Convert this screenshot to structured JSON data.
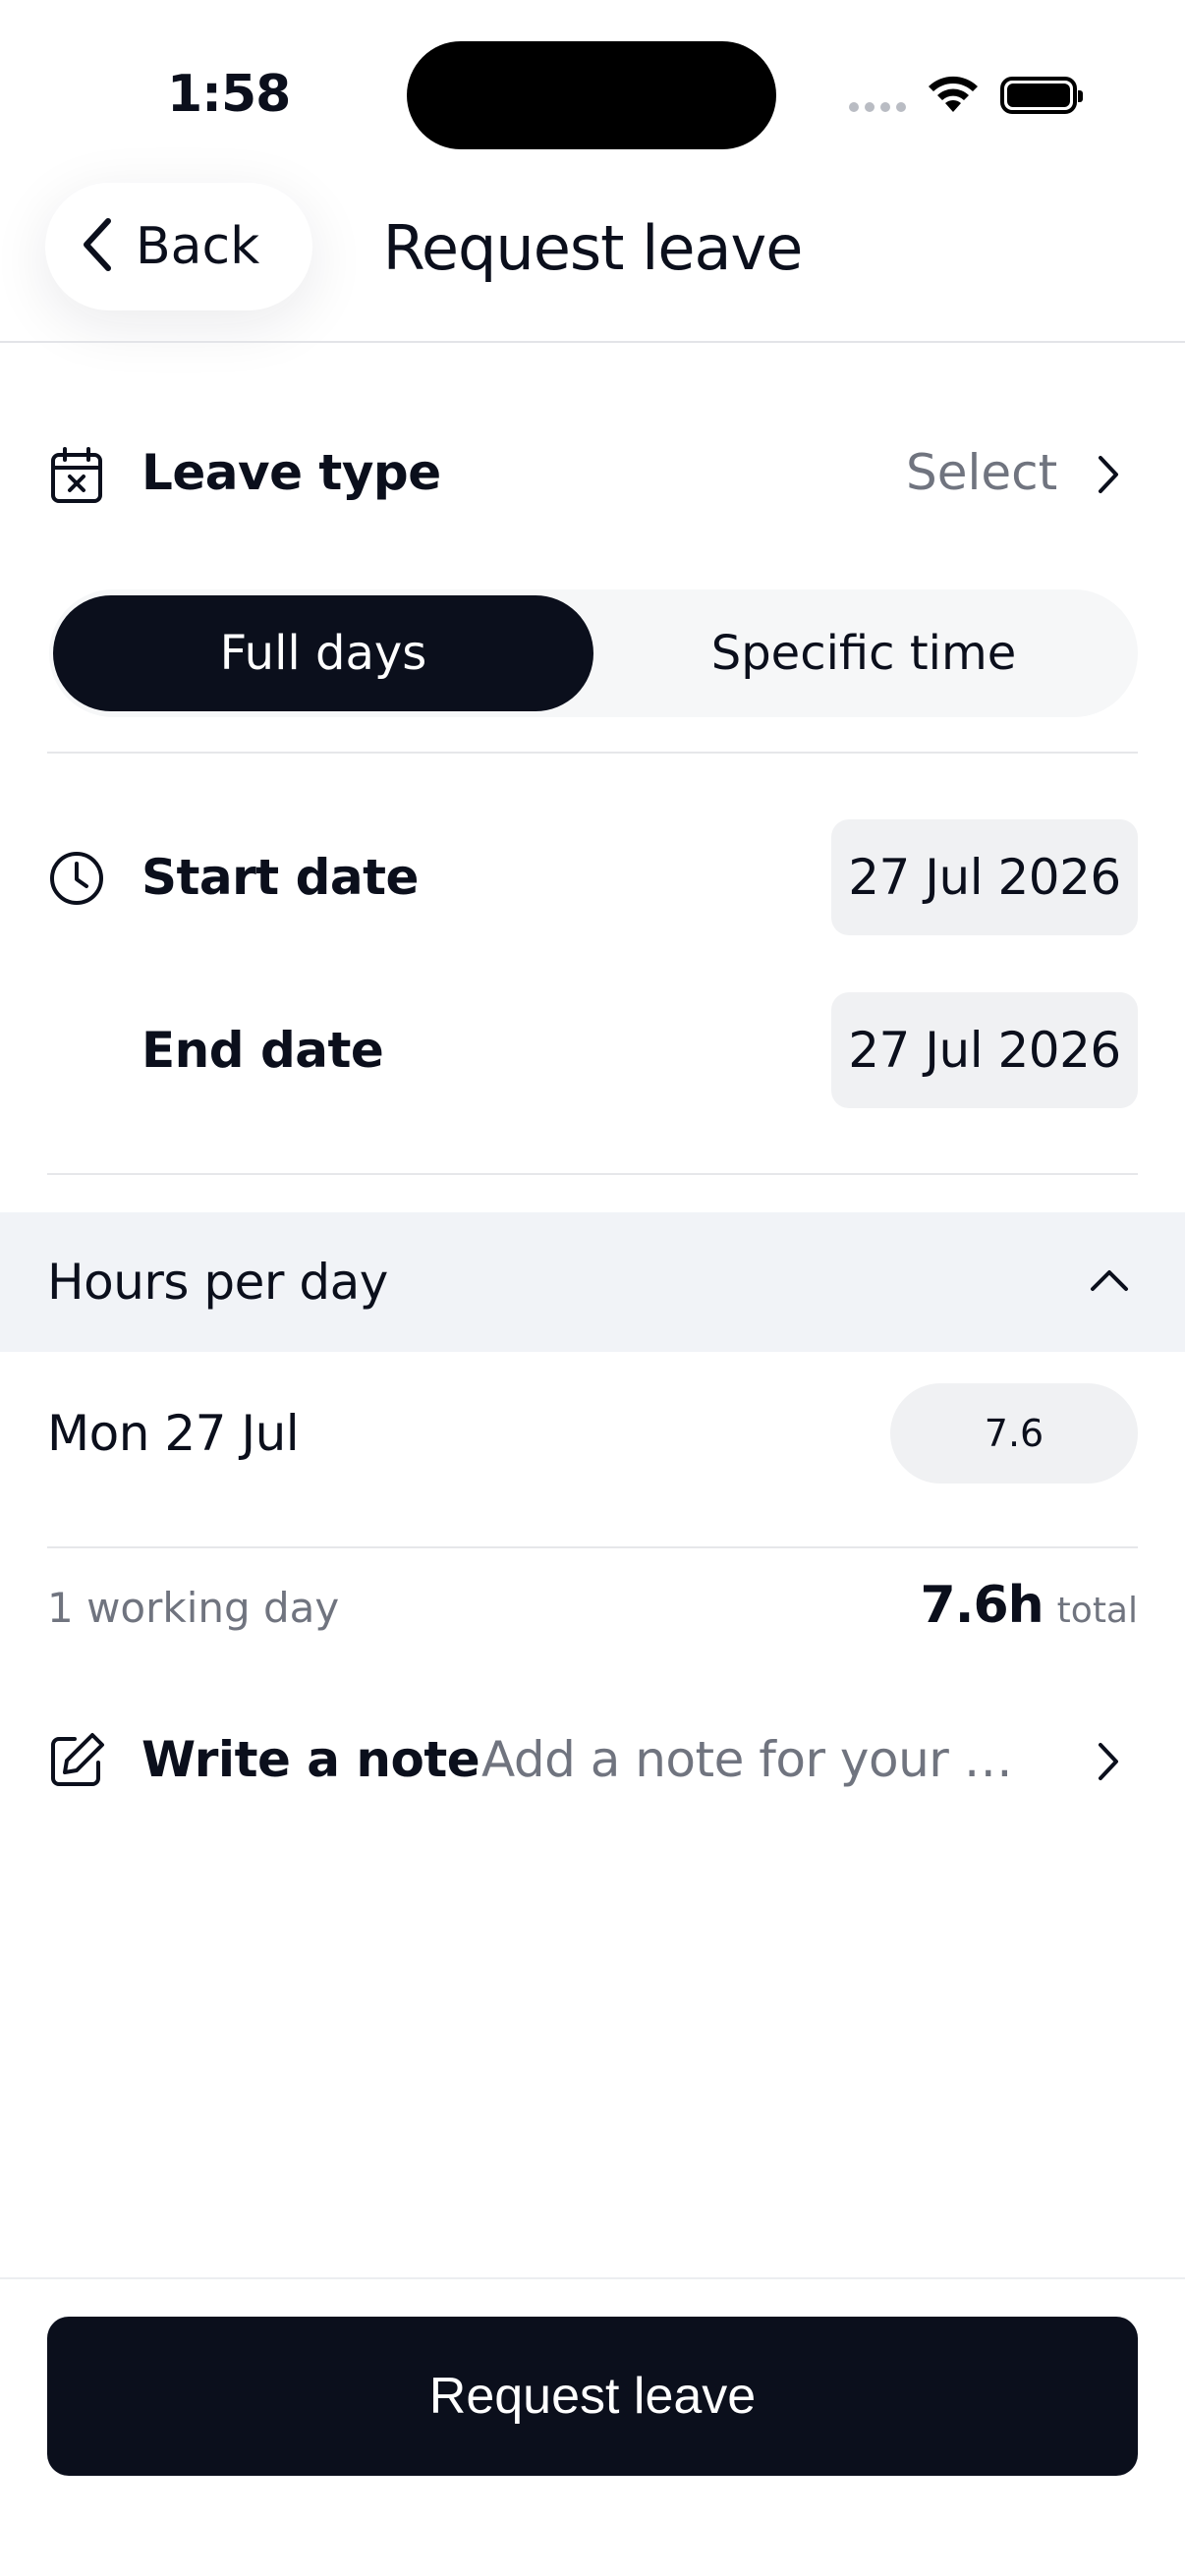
{
  "status_bar": {
    "time": "1:58"
  },
  "header": {
    "back_label": "Back",
    "title": "Request leave"
  },
  "leave_type": {
    "label": "Leave type",
    "value": "Select"
  },
  "mode_toggle": {
    "options": [
      "Full days",
      "Specific time"
    ],
    "selected": "Full days"
  },
  "dates": {
    "start_label": "Start date",
    "start_value": "27 Jul 2026",
    "end_label": "End date",
    "end_value": "27 Jul 2026"
  },
  "hours_per_day": {
    "title": "Hours per day",
    "expanded": true,
    "days": [
      {
        "label": "Mon 27 Jul",
        "hours": "7.6"
      }
    ]
  },
  "summary": {
    "working_days": "1 working day",
    "total_value": "7.6h",
    "total_unit": "total"
  },
  "note": {
    "label": "Write a note",
    "placeholder": "Add a note for your manager"
  },
  "submit": {
    "label": "Request leave"
  },
  "colors": {
    "primary": "#0b0f1c",
    "muted_text": "#70747f",
    "pill_bg": "#f0f1f3",
    "section_bg": "#f1f3f7"
  },
  "icons": [
    "chevron-left-icon",
    "calendar-x-icon",
    "chevron-right-icon",
    "clock-icon",
    "chevron-up-icon",
    "edit-note-icon",
    "wifi-icon",
    "battery-icon",
    "signal-icon"
  ]
}
